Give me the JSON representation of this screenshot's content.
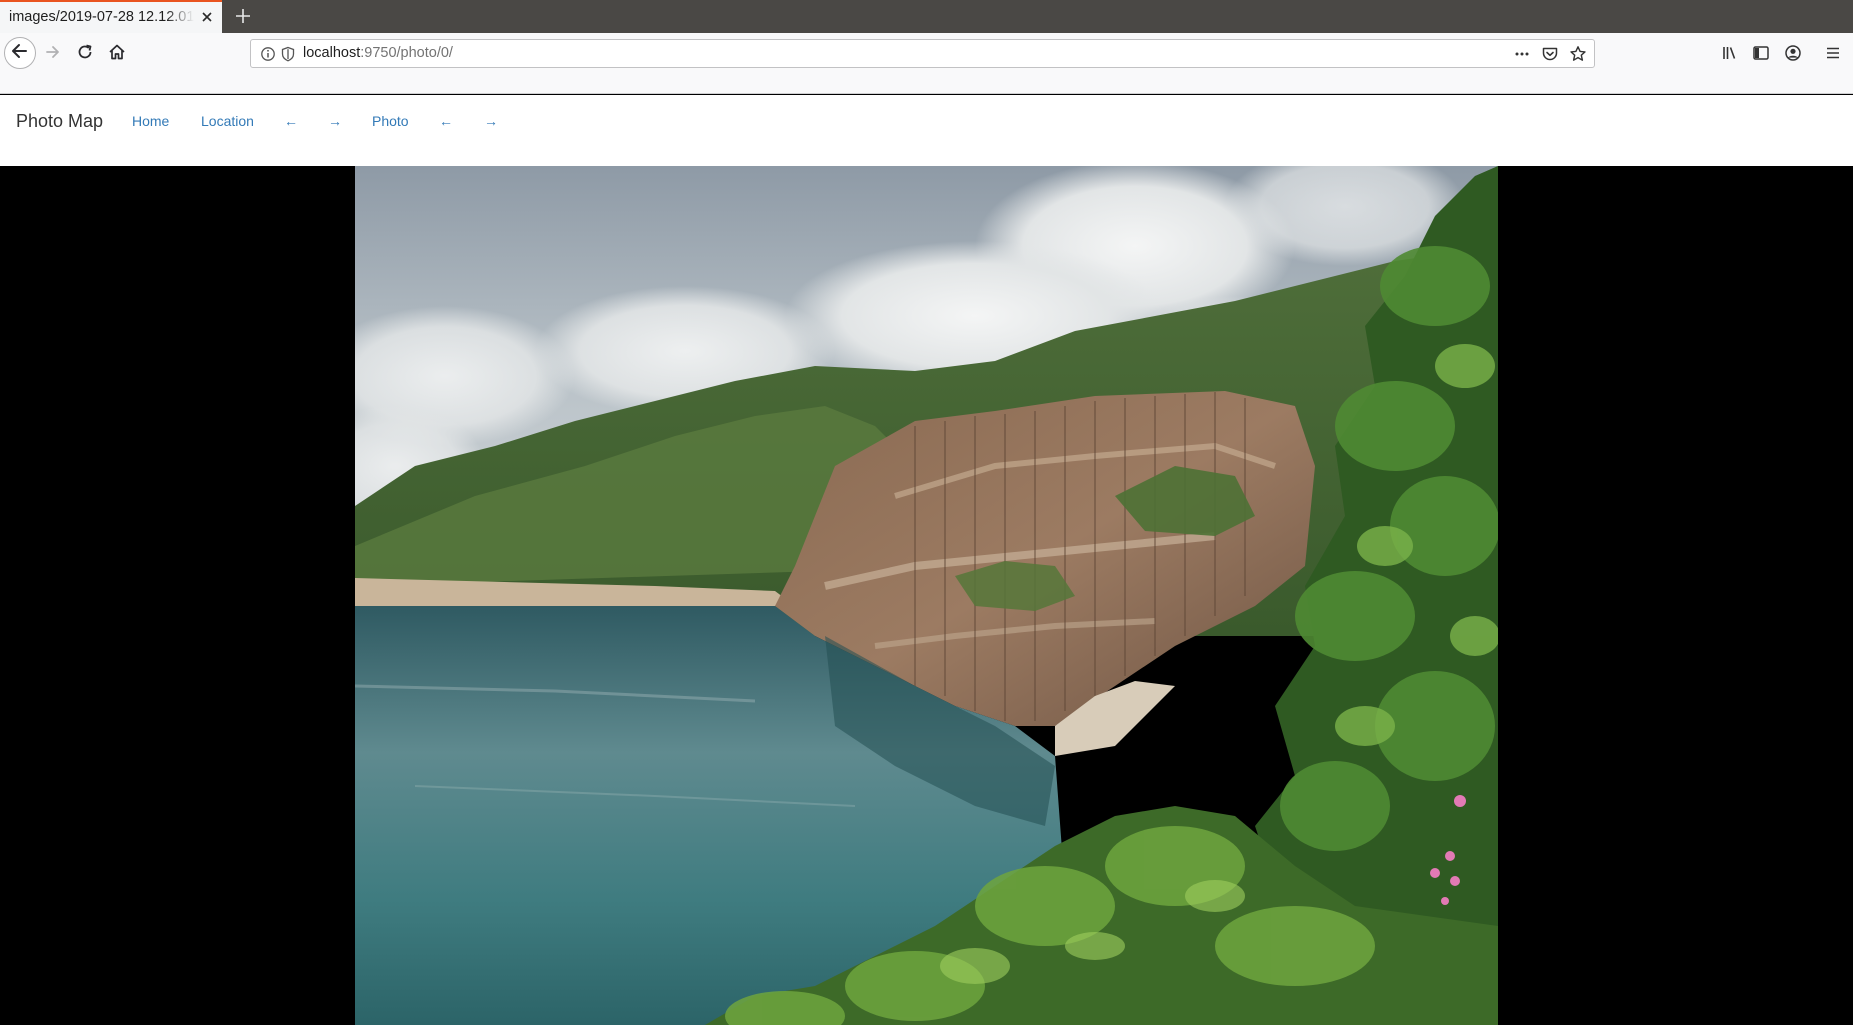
{
  "browser": {
    "tab_title": "images/2019-07-28 12.12.01",
    "url_host": "localhost",
    "url_path": ":9750/photo/0/"
  },
  "icons": {
    "back": "back-arrow-icon",
    "forward": "forward-arrow-icon",
    "reload": "reload-icon",
    "home": "home-icon",
    "info": "info-icon",
    "tracking": "shield-icon",
    "more": "more-actions-icon",
    "pocket": "pocket-icon",
    "bookmark": "star-icon",
    "library": "library-icon",
    "sidebar": "sidebar-icon",
    "account": "account-icon",
    "menu": "hamburger-menu-icon"
  },
  "nav": {
    "brand": "Photo Map",
    "home": "Home",
    "location": "Location",
    "location_prev": "←",
    "location_next": "→",
    "photo": "Photo",
    "photo_prev": "←",
    "photo_next": "→"
  },
  "colors": {
    "link": "#337ab7",
    "tab_accent": "#e95420"
  }
}
